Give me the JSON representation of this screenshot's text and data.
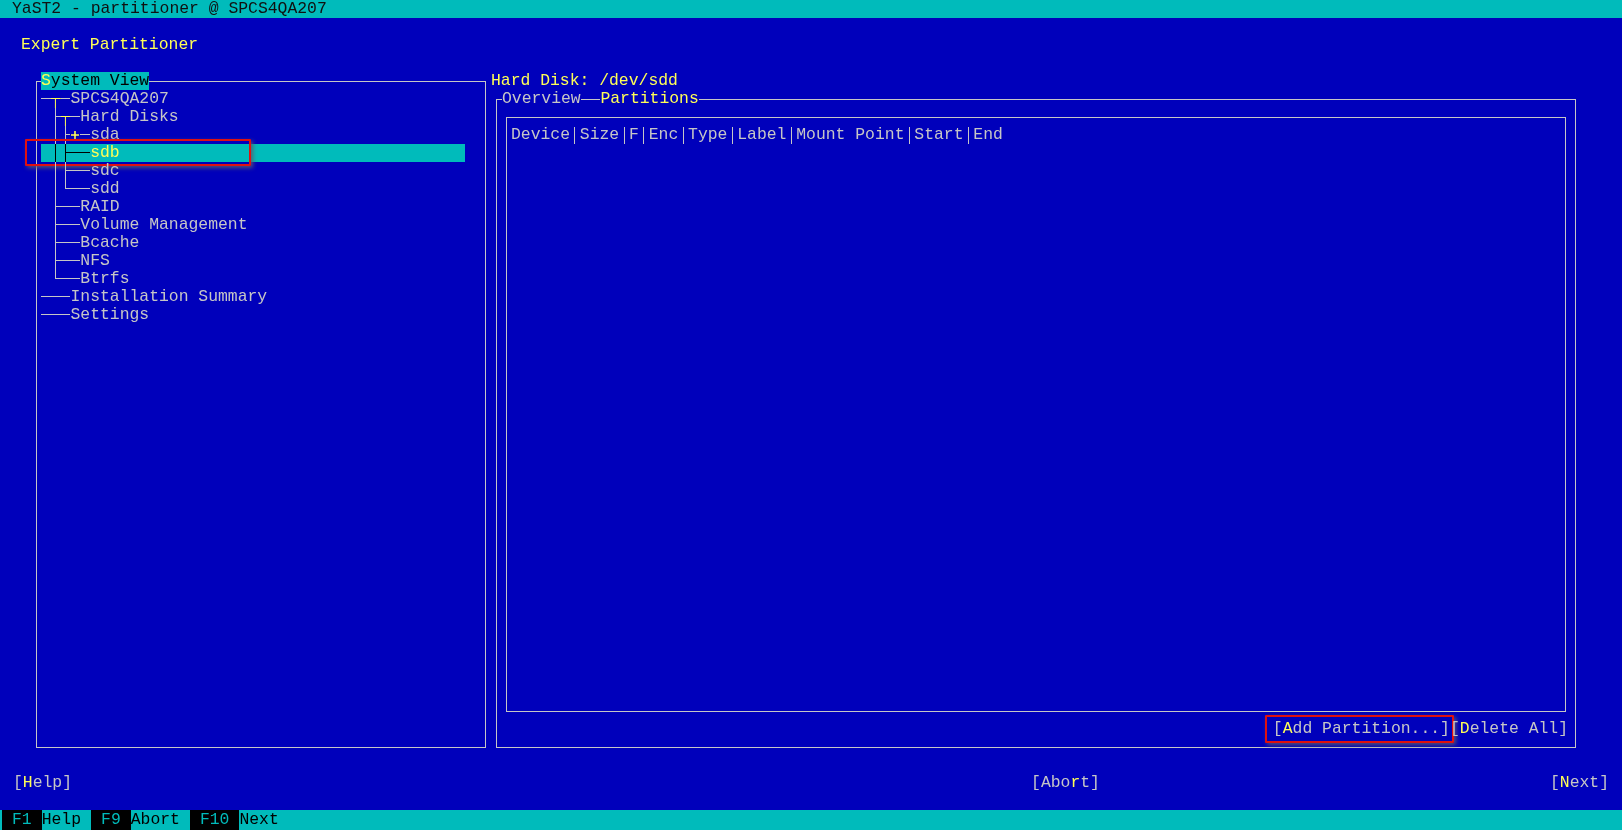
{
  "window": {
    "title": "YaST2 - partitioner @ SPCS4QA207"
  },
  "heading": "Expert Partitioner",
  "system_view": {
    "title": "**S**ystem View",
    "tree": [
      {
        "label": "SPCS4QA207",
        "selected": false,
        "highlighted": false,
        "expanded": true,
        "children": [
          {
            "label": "Hard Disks",
            "selected": false,
            "highlighted": false,
            "expanded": true,
            "children": [
              {
                "label": "sda",
                "selected": false,
                "highlighted": false,
                "expanded": false
              },
              {
                "label": "sdb",
                "selected": true,
                "highlighted": true
              },
              {
                "label": "sdc",
                "selected": false,
                "highlighted": false
              },
              {
                "label": "sdd",
                "selected": false,
                "highlighted": false
              }
            ]
          },
          {
            "label": "RAID",
            "selected": false,
            "highlighted": false
          },
          {
            "label": "Volume Management",
            "selected": false,
            "highlighted": false
          },
          {
            "label": "Bcache",
            "selected": false,
            "highlighted": false
          },
          {
            "label": "NFS",
            "selected": false,
            "highlighted": false
          },
          {
            "label": "Btrfs",
            "selected": false,
            "highlighted": false
          }
        ]
      },
      {
        "label": "Installation Summary",
        "selected": false,
        "highlighted": false
      },
      {
        "label": "Settings",
        "selected": false,
        "highlighted": false
      }
    ]
  },
  "detail": {
    "title": "Hard Disk: /dev/sdd",
    "tabs": [
      {
        "label": "Overview",
        "selected": false
      },
      {
        "label": "Partitions",
        "selected": true
      }
    ],
    "table": {
      "columns": [
        "Device",
        "Size",
        "F",
        "Enc",
        "Type",
        "Label",
        "Mount Point",
        "Start",
        "End"
      ]
    },
    "buttons": [
      {
        "label": "[**A**dd Partition...]",
        "highlighted": true
      },
      {
        "label": "[**D**elete All]",
        "highlighted": false
      }
    ]
  },
  "buttons": [
    {
      "label": "[**H**elp]"
    },
    {
      "label": "[Abo**r**t]"
    },
    {
      "label": "[**N**ext]"
    }
  ],
  "function_keys": [
    {
      "key": "F1",
      "label": "Help"
    },
    {
      "key": "F9",
      "label": "Abort"
    },
    {
      "key": "F10",
      "label": "Next"
    }
  ]
}
